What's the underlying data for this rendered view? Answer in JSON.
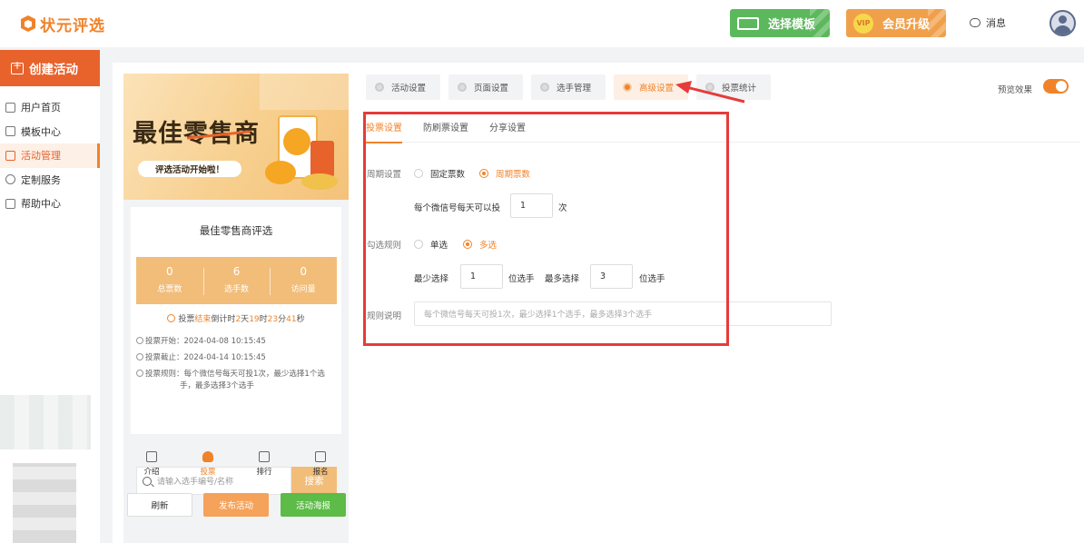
{
  "header": {
    "logo_text": "状元评选",
    "template_button": "选择模板",
    "vip_badge": "VIP",
    "vip_button": "会员升级",
    "messages": "消息"
  },
  "sidebar": {
    "create_button": "创建活动",
    "items": [
      {
        "label": "用户首页",
        "icon": "home-icon"
      },
      {
        "label": "模板中心",
        "icon": "folder-icon"
      },
      {
        "label": "活动管理",
        "icon": "list-icon",
        "active": true
      },
      {
        "label": "定制服务",
        "icon": "service-icon"
      },
      {
        "label": "帮助中心",
        "icon": "help-icon"
      }
    ]
  },
  "preview": {
    "banner_title": "最佳零售商",
    "banner_subtitle": "评选活动开始啦！",
    "card_title": "最佳零售商评选",
    "stats": [
      {
        "value": "0",
        "label": "总票数"
      },
      {
        "value": "6",
        "label": "选手数"
      },
      {
        "value": "0",
        "label": "访问量"
      }
    ],
    "countdown": {
      "prefix": "投票",
      "status": "结束",
      "middle": "倒计时",
      "days": "2",
      "days_unit": "天",
      "hours": "19",
      "hours_unit": "时",
      "minutes": "23",
      "minutes_unit": "分",
      "seconds": "41",
      "seconds_unit": "秒"
    },
    "vote_start": "投票开始：2024-04-08 10:15:45",
    "vote_end": "投票截止：2024-04-14 10:15:45",
    "vote_rule_line1": "投票规则：每个微信号每天可投1次，最少选择1个选",
    "vote_rule_line2": "手，最多选择3个选手",
    "search_placeholder": "请输入选手编号/名称",
    "search_button": "搜索",
    "tabs": [
      {
        "label": "介绍",
        "icon": "intro-icon"
      },
      {
        "label": "投票",
        "icon": "vote-icon",
        "active": true
      },
      {
        "label": "排行",
        "icon": "rank-icon"
      },
      {
        "label": "报名",
        "icon": "signup-icon"
      }
    ],
    "actions": {
      "refresh": "刷新",
      "publish": "发布活动",
      "poster": "活动海报"
    }
  },
  "settings": {
    "tabs": [
      {
        "label": "活动设置",
        "icon": "activity-settings-icon"
      },
      {
        "label": "页面设置",
        "icon": "page-settings-icon"
      },
      {
        "label": "选手管理",
        "icon": "contestant-icon"
      },
      {
        "label": "高级设置",
        "icon": "advanced-settings-icon",
        "active": true
      },
      {
        "label": "投票统计",
        "icon": "stats-icon"
      }
    ],
    "preview_label": "预览效果",
    "preview_enabled": true,
    "subtabs": [
      {
        "label": "投票设置",
        "active": true
      },
      {
        "label": "防刷票设置"
      },
      {
        "label": "分享设置"
      }
    ],
    "period": {
      "label": "周期设置",
      "options": [
        "固定票数",
        "周期票数"
      ],
      "selected": "周期票数",
      "per_day_prefix": "每个微信号每天可以投",
      "per_day_value": "1",
      "per_day_suffix": "次"
    },
    "selection": {
      "label": "勾选规则",
      "options": [
        "单选",
        "多选"
      ],
      "selected": "多选",
      "min_label": "最少选择",
      "min_value": "1",
      "min_unit": "位选手",
      "max_label": "最多选择",
      "max_value": "3",
      "max_unit": "位选手"
    },
    "rules": {
      "label": "规则说明",
      "placeholder": "每个微信号每天可投1次，最少选择1个选手，最多选择3个选手"
    }
  },
  "colors": {
    "accent": "#f0832a",
    "annotation_red": "#e63b3b",
    "template_green": "#5cb85c",
    "poster_green": "#5dbb47"
  }
}
